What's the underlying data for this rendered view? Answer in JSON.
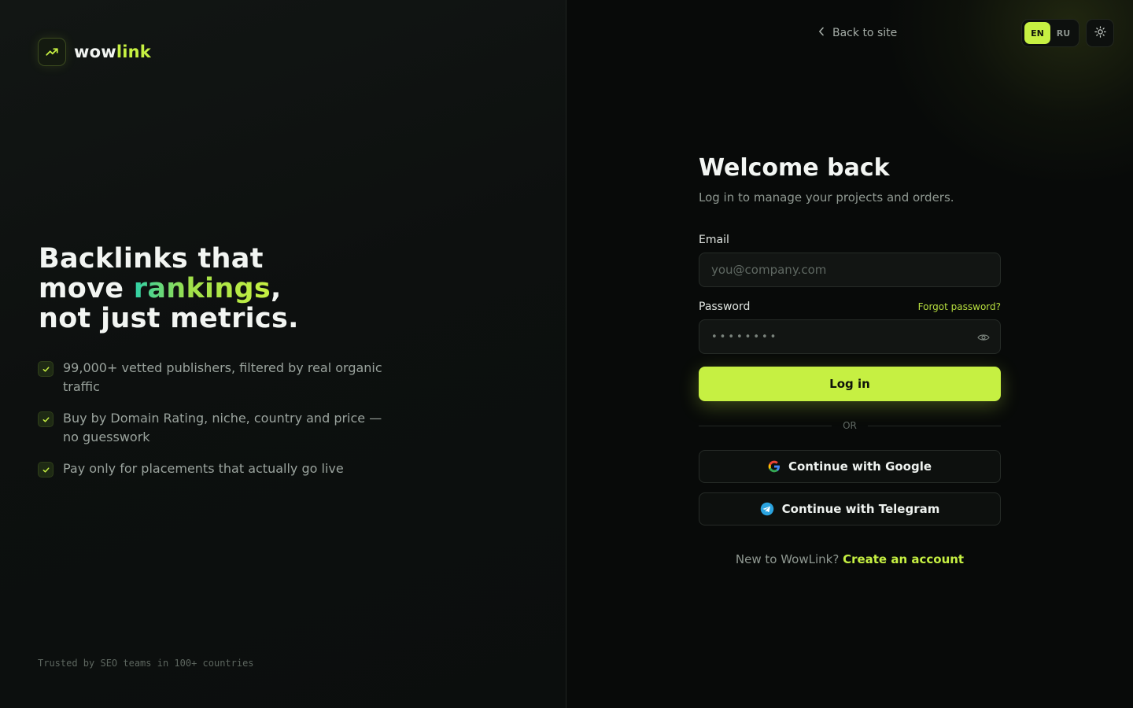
{
  "brand": {
    "name_part1": "wow",
    "name_part2": "link"
  },
  "hero": {
    "line1": "Backlinks that",
    "line2_pre": "move ",
    "line2_highlight": "rankings",
    "line2_post": ",",
    "line3": "not just metrics."
  },
  "features": [
    "99,000+ vetted publishers, filtered by real organic traffic",
    "Buy by Domain Rating, niche, country and price — no guesswork",
    "Pay only for placements that actually go live"
  ],
  "trusted": "Trusted by SEO teams in 100+ countries",
  "topbar": {
    "back_label": "Back to site",
    "languages": [
      "EN",
      "RU"
    ],
    "active_language": "EN"
  },
  "form": {
    "title": "Welcome back",
    "subtitle": "Log in to manage your projects and orders.",
    "email_label": "Email",
    "email_placeholder": "you@company.com",
    "password_label": "Password",
    "forgot_label": "Forgot password?",
    "password_placeholder": "••••••••",
    "login_label": "Log in",
    "or_label": "OR",
    "google_label": "Continue with Google",
    "telegram_label": "Continue with Telegram",
    "signup_prompt": "New to WowLink?",
    "signup_link": "Create an account"
  },
  "colors": {
    "accent": "#c6f042",
    "background": "#0a0c0b",
    "telegram": "#2aa3df"
  },
  "icons": {
    "logo": "trending-up-icon",
    "feature": "check-icon",
    "back": "chevron-left-icon",
    "theme": "sun-icon",
    "password_toggle": "eye-icon",
    "google": "google-icon",
    "telegram": "telegram-icon"
  }
}
